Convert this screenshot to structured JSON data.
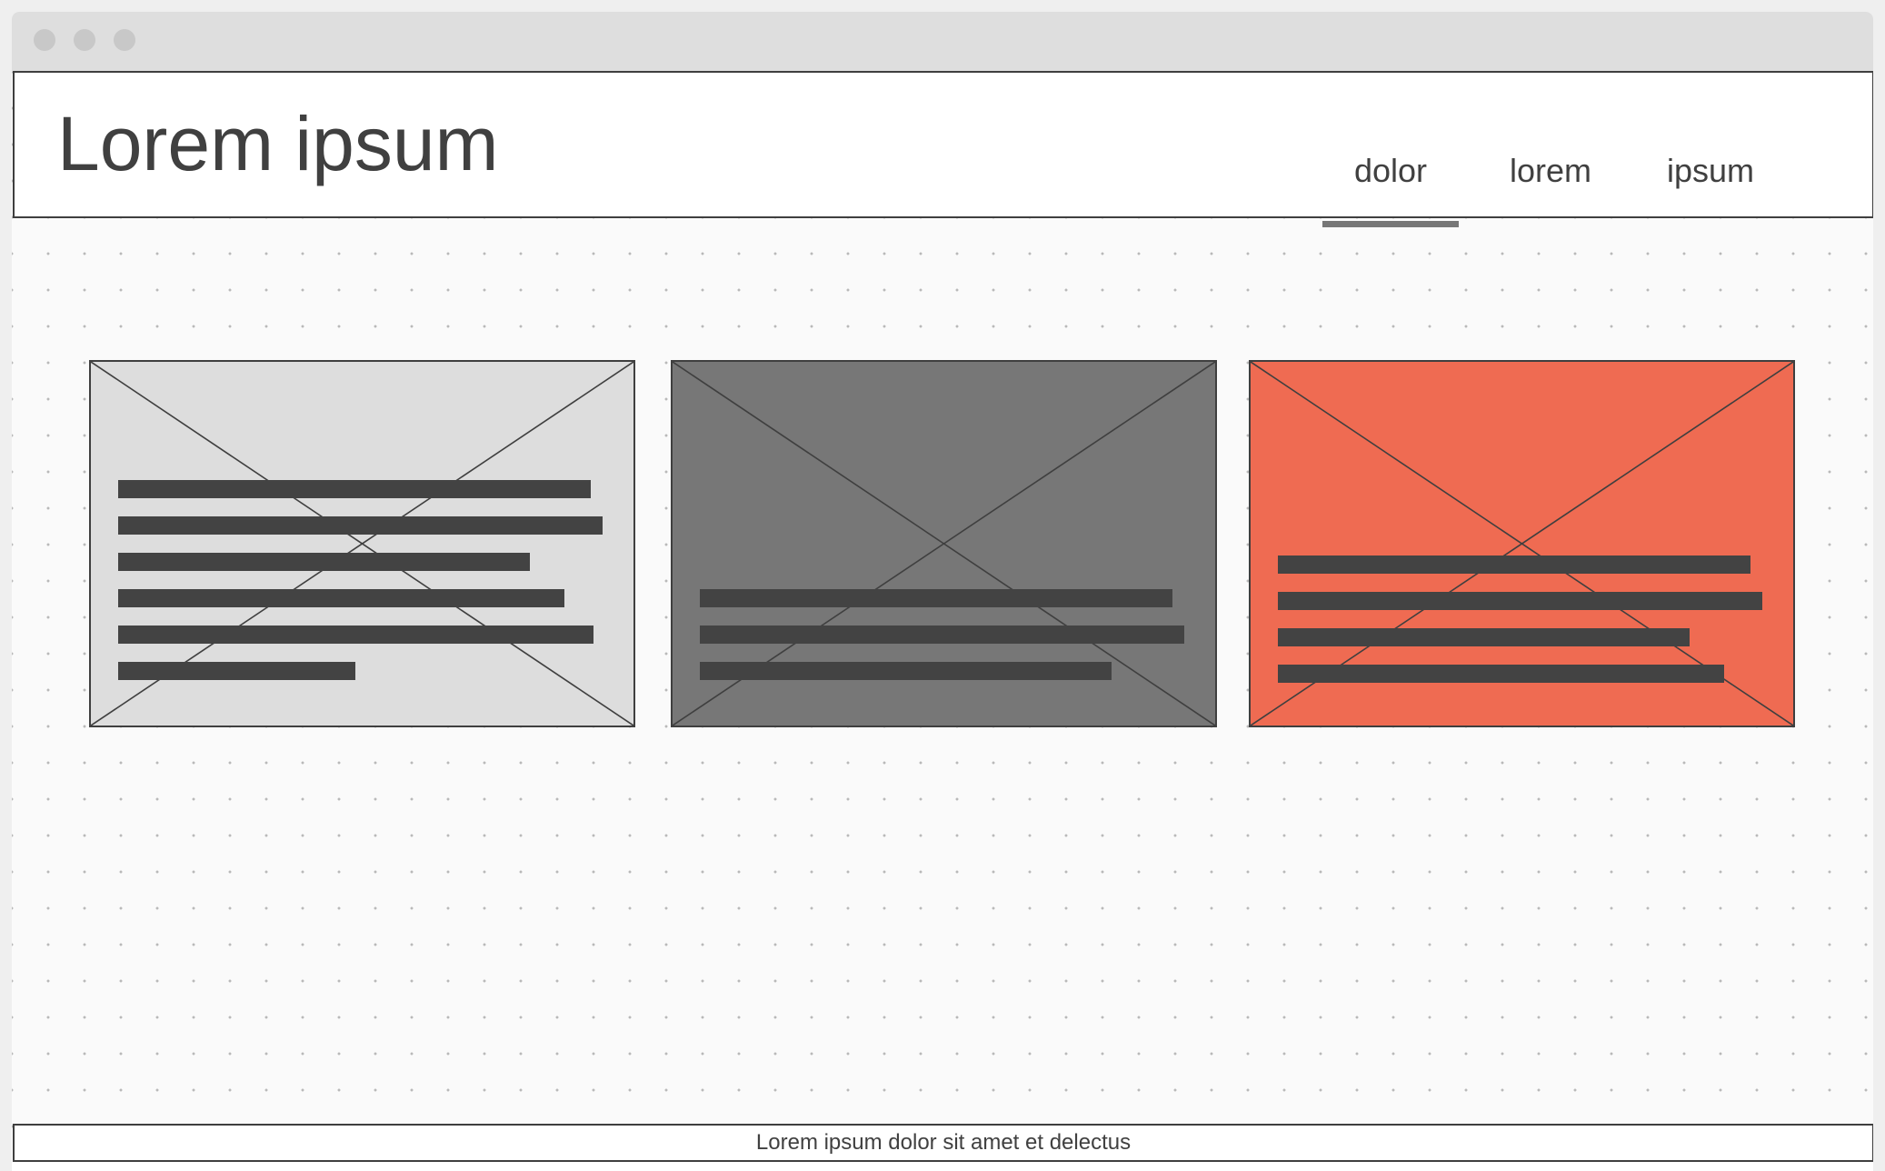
{
  "header": {
    "title": "Lorem ipsum",
    "nav": [
      {
        "label": "dolor",
        "active": true
      },
      {
        "label": "lorem",
        "active": false
      },
      {
        "label": "ipsum",
        "active": false
      }
    ]
  },
  "cards": [
    {
      "background": "#dddddd",
      "line_count": 6
    },
    {
      "background": "#777777",
      "line_count": 3
    },
    {
      "background": "#ef6b52",
      "line_count": 4
    }
  ],
  "footer": {
    "text": "Lorem ipsum dolor sit amet et delectus"
  },
  "colors": {
    "window_chrome": "#dedede",
    "text": "#404040",
    "text_bar": "#434343",
    "border": "#3f3f3f",
    "accent": "#ef6b52"
  }
}
